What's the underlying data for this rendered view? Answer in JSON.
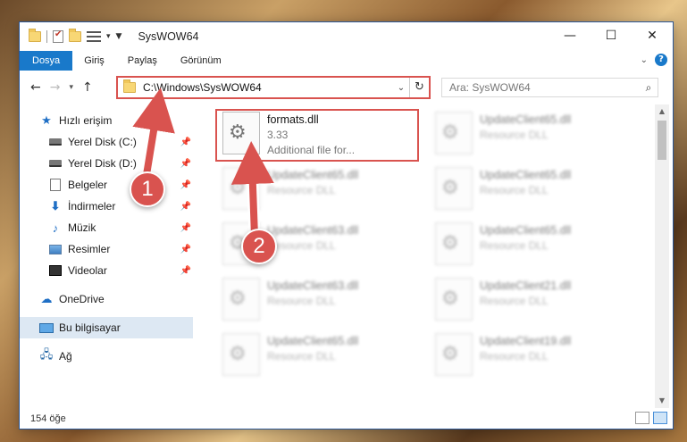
{
  "window": {
    "title": "SysWOW64",
    "controls": {
      "minimize": "—",
      "maximize": "☐",
      "close": "✕"
    }
  },
  "ribbon": {
    "tabs": [
      "Dosya",
      "Giriş",
      "Paylaş",
      "Görünüm"
    ]
  },
  "address": {
    "path": "C:\\Windows\\SysWOW64",
    "search_placeholder": "Ara: SysWOW64"
  },
  "nav_pane": {
    "items": [
      {
        "label": "Hızlı erişim",
        "icon": "star-icon"
      },
      {
        "label": "Yerel Disk (C:)",
        "icon": "drive-icon",
        "pinned": true
      },
      {
        "label": "Yerel Disk (D:)",
        "icon": "drive-icon",
        "pinned": true
      },
      {
        "label": "Belgeler",
        "icon": "document-icon",
        "pinned": true
      },
      {
        "label": "İndirmeler",
        "icon": "download-icon",
        "pinned": true
      },
      {
        "label": "Müzik",
        "icon": "music-icon",
        "pinned": true
      },
      {
        "label": "Resimler",
        "icon": "pictures-icon",
        "pinned": true
      },
      {
        "label": "Videolar",
        "icon": "videos-icon",
        "pinned": true
      },
      {
        "label": "OneDrive",
        "icon": "cloud-icon"
      },
      {
        "label": "Bu bilgisayar",
        "icon": "computer-icon",
        "selected": true
      },
      {
        "label": "Ağ",
        "icon": "network-icon"
      }
    ]
  },
  "files": [
    {
      "name": "formats.dll",
      "line2": "3.33",
      "line3": "Additional file for..."
    },
    {
      "name": "UpdateClient65.dll",
      "type": "Resource DLL"
    },
    {
      "name": "UpdateClient65.dll",
      "type": "Resource DLL"
    },
    {
      "name": "UpdateClient65.dll",
      "type": "Resource DLL"
    },
    {
      "name": "UpdateClient63.dll",
      "type": "Resource DLL"
    },
    {
      "name": "UpdateClient65.dll",
      "type": "Resource DLL"
    },
    {
      "name": "UpdateClient63.dll",
      "type": "Resource DLL"
    },
    {
      "name": "UpdateClient21.dll",
      "type": "Resource DLL"
    },
    {
      "name": "UpdateClient65.dll",
      "type": "Resource DLL"
    },
    {
      "name": "UpdateClient19.dll",
      "type": "Resource DLL"
    }
  ],
  "status": {
    "item_count": "154 öğe"
  },
  "annotations": {
    "badge1": "1",
    "badge2": "2"
  },
  "colors": {
    "accent": "#1979ca",
    "highlight": "#d9534f"
  }
}
